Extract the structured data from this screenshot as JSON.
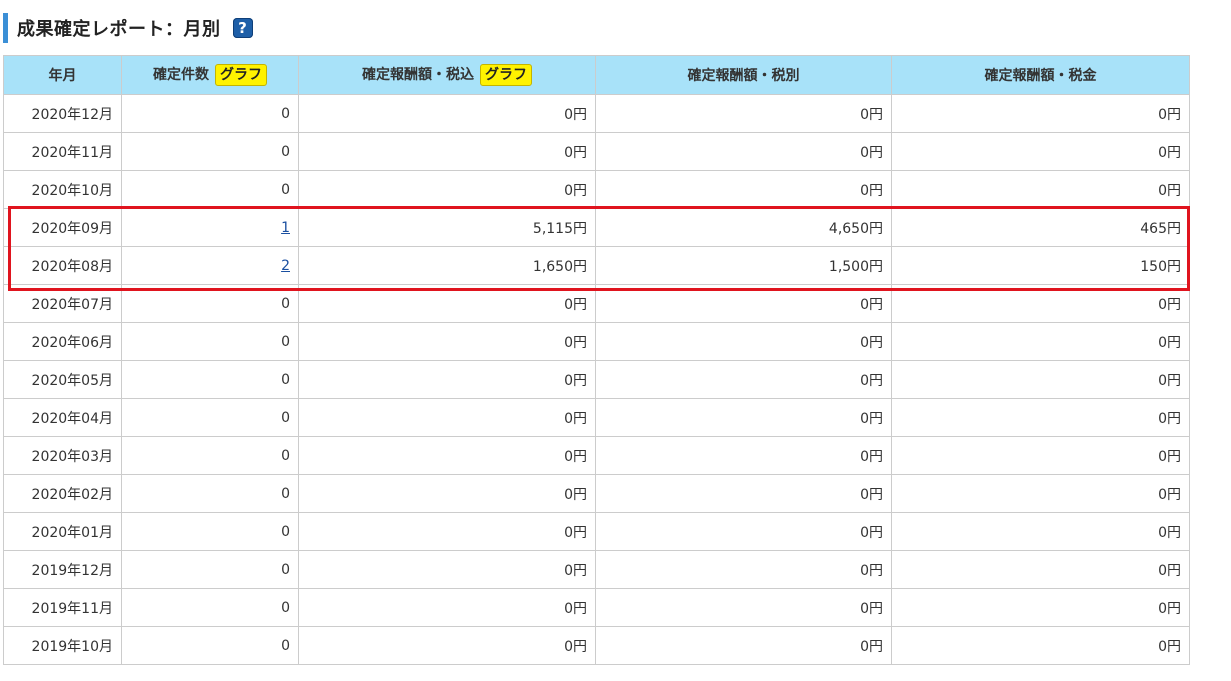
{
  "page": {
    "title": "成果確定レポート：月別",
    "help_icon": "?"
  },
  "table": {
    "headers": {
      "month": "年月",
      "count": "確定件数",
      "tax_incl": "確定報酬額・税込",
      "tax_excl": "確定報酬額・税別",
      "tax": "確定報酬額・税金",
      "graph_label": "グラフ"
    },
    "rows": [
      {
        "month": "2020年12月",
        "count": "0",
        "tax_incl": "0円",
        "tax_excl": "0円",
        "tax": "0円"
      },
      {
        "month": "2020年11月",
        "count": "0",
        "tax_incl": "0円",
        "tax_excl": "0円",
        "tax": "0円"
      },
      {
        "month": "2020年10月",
        "count": "0",
        "tax_incl": "0円",
        "tax_excl": "0円",
        "tax": "0円"
      },
      {
        "month": "2020年09月",
        "count": "1",
        "tax_incl": "5,115円",
        "tax_excl": "4,650円",
        "tax": "465円"
      },
      {
        "month": "2020年08月",
        "count": "2",
        "tax_incl": "1,650円",
        "tax_excl": "1,500円",
        "tax": "150円"
      },
      {
        "month": "2020年07月",
        "count": "0",
        "tax_incl": "0円",
        "tax_excl": "0円",
        "tax": "0円"
      },
      {
        "month": "2020年06月",
        "count": "0",
        "tax_incl": "0円",
        "tax_excl": "0円",
        "tax": "0円"
      },
      {
        "month": "2020年05月",
        "count": "0",
        "tax_incl": "0円",
        "tax_excl": "0円",
        "tax": "0円"
      },
      {
        "month": "2020年04月",
        "count": "0",
        "tax_incl": "0円",
        "tax_excl": "0円",
        "tax": "0円"
      },
      {
        "month": "2020年03月",
        "count": "0",
        "tax_incl": "0円",
        "tax_excl": "0円",
        "tax": "0円"
      },
      {
        "month": "2020年02月",
        "count": "0",
        "tax_incl": "0円",
        "tax_excl": "0円",
        "tax": "0円"
      },
      {
        "month": "2020年01月",
        "count": "0",
        "tax_incl": "0円",
        "tax_excl": "0円",
        "tax": "0円"
      },
      {
        "month": "2019年12月",
        "count": "0",
        "tax_incl": "0円",
        "tax_excl": "0円",
        "tax": "0円"
      },
      {
        "month": "2019年11月",
        "count": "0",
        "tax_incl": "0円",
        "tax_excl": "0円",
        "tax": "0円"
      },
      {
        "month": "2019年10月",
        "count": "0",
        "tax_incl": "0円",
        "tax_excl": "0円",
        "tax": "0円"
      }
    ]
  },
  "colors": {
    "header_bg": "#a8e2f9",
    "accent": "#3b8fd6",
    "highlight_border": "#e0141e",
    "graph_button": "#fff200",
    "link": "#1a4fa0"
  }
}
